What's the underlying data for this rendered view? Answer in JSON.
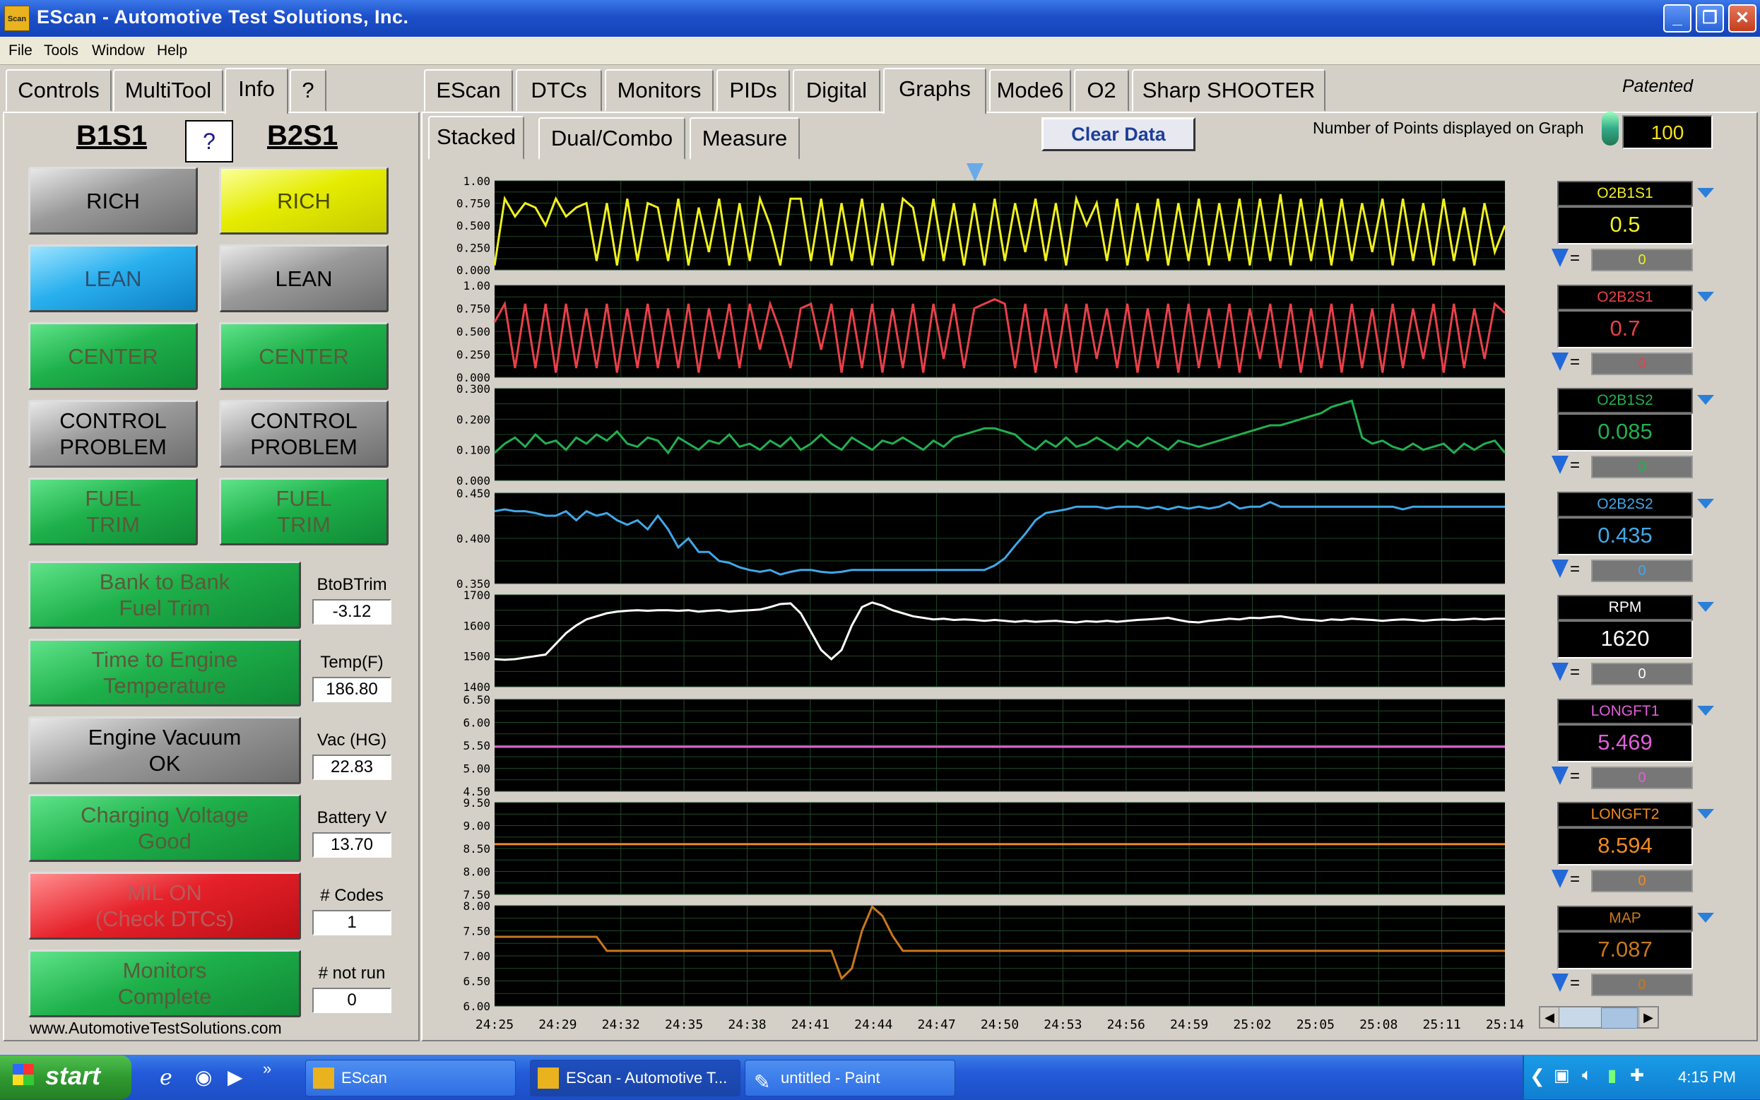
{
  "window": {
    "title": "EScan - Automotive Test Solutions, Inc.",
    "app_icon_text": "Scan"
  },
  "menu": [
    "File",
    "Tools",
    "Window",
    "Help"
  ],
  "left_tabs": [
    "Controls",
    "MultiTool",
    "Info",
    "?"
  ],
  "main_tabs": [
    "EScan",
    "DTCs",
    "Monitors",
    "PIDs",
    "Digital",
    "Graphs",
    "Mode6",
    "O2",
    "Sharp SHOOTER"
  ],
  "selected_main_tab": "Graphs",
  "patented": "Patented",
  "sub_tabs": [
    "Stacked",
    "Dual/Combo",
    "Measure"
  ],
  "clear_button": "Clear Data",
  "points_label": "Number of Points displayed on Graph",
  "points_value": "100",
  "banks": {
    "left": "B1S1",
    "help": "?",
    "right": "B2S1"
  },
  "b1s1": [
    {
      "text": "RICH",
      "color": "gray"
    },
    {
      "text": "LEAN",
      "color": "blue"
    },
    {
      "text": "CENTER",
      "color": "green"
    },
    {
      "text": "CONTROL\nPROBLEM",
      "color": "gray"
    },
    {
      "text": "FUEL\nTRIM",
      "color": "green"
    }
  ],
  "b2s1": [
    {
      "text": "RICH",
      "color": "yellow"
    },
    {
      "text": "LEAN",
      "color": "gray"
    },
    {
      "text": "CENTER",
      "color": "green"
    },
    {
      "text": "CONTROL\nPROBLEM",
      "color": "gray"
    },
    {
      "text": "FUEL\nTRIM",
      "color": "green"
    }
  ],
  "status_rows": [
    {
      "text": "Bank to Bank\nFuel Trim",
      "color": "green",
      "label": "BtoBTrim",
      "value": "-3.12"
    },
    {
      "text": "Time to Engine\nTemperature",
      "color": "green",
      "label": "Temp(F)",
      "value": "186.80"
    },
    {
      "text": "Engine Vacuum\nOK",
      "color": "gray",
      "label": "Vac (HG)",
      "value": "22.83"
    },
    {
      "text": "Charging Voltage\nGood",
      "color": "green",
      "label": "Battery V",
      "value": "13.70"
    },
    {
      "text": "MIL ON\n(Check DTCs)",
      "color": "red",
      "label": "# Codes",
      "value": "1"
    },
    {
      "text": "Monitors\nComplete",
      "color": "green",
      "label": "# not run",
      "value": "0"
    }
  ],
  "website": "www.AutomotiveTestSolutions.com",
  "x_ticks": [
    "24:25",
    "24:29",
    "24:32",
    "24:35",
    "24:38",
    "24:41",
    "24:44",
    "24:47",
    "24:50",
    "24:53",
    "24:56",
    "24:59",
    "25:02",
    "25:05",
    "25:08",
    "25:11",
    "25:14"
  ],
  "channels": [
    {
      "name": "O2B1S1",
      "value": "0.5",
      "cursor": "0",
      "color": "#f0f020",
      "ticks": [
        "1.00",
        "0.750",
        "0.500",
        "0.250",
        "0.000"
      ],
      "min": 0,
      "max": 1
    },
    {
      "name": "O2B2S1",
      "value": "0.7",
      "cursor": "0",
      "color": "#e8404a",
      "ticks": [
        "1.00",
        "0.750",
        "0.500",
        "0.250",
        "0.000"
      ],
      "min": 0,
      "max": 1
    },
    {
      "name": "O2B1S2",
      "value": "0.085",
      "cursor": "0",
      "color": "#22b050",
      "ticks": [
        "0.300",
        "0.200",
        "0.100",
        "0.000"
      ],
      "min": 0,
      "max": 0.3
    },
    {
      "name": "O2B2S2",
      "value": "0.435",
      "cursor": "0",
      "color": "#40a8e8",
      "ticks": [
        "0.450",
        "0.400",
        "0.350"
      ],
      "min": 0.35,
      "max": 0.45
    },
    {
      "name": "RPM",
      "value": "1620",
      "cursor": "0",
      "color": "#ffffff",
      "ticks": [
        "1700",
        "1600",
        "1500",
        "1400"
      ],
      "min": 1400,
      "max": 1700
    },
    {
      "name": "LONGFT1",
      "value": "5.469",
      "cursor": "0",
      "color": "#e060d8",
      "ticks": [
        "6.50",
        "6.00",
        "5.50",
        "5.00",
        "4.50"
      ],
      "min": 4.5,
      "max": 6.5
    },
    {
      "name": "LONGFT2",
      "value": "8.594",
      "cursor": "0",
      "color": "#f08a20",
      "ticks": [
        "9.50",
        "9.00",
        "8.50",
        "8.00",
        "7.50"
      ],
      "min": 7.5,
      "max": 9.5
    },
    {
      "name": "MAP",
      "value": "7.087",
      "cursor": "0",
      "color": "#c8781c",
      "ticks": [
        "8.00",
        "7.50",
        "7.00",
        "6.50",
        "6.00"
      ],
      "min": 6,
      "max": 8
    }
  ],
  "chart_data": {
    "type": "line",
    "title": "",
    "x": "time",
    "series": [
      {
        "name": "O2B1S1",
        "values": [
          0.05,
          0.8,
          0.6,
          0.75,
          0.7,
          0.5,
          0.8,
          0.6,
          0.7,
          0.75,
          0.1,
          0.75,
          0.05,
          0.8,
          0.1,
          0.75,
          0.7,
          0.1,
          0.8,
          0.05,
          0.7,
          0.2,
          0.8,
          0.05,
          0.75,
          0.1,
          0.8,
          0.5,
          0.05,
          0.8,
          0.8,
          0.1,
          0.8,
          0.05,
          0.75,
          0.1,
          0.8,
          0.05,
          0.75,
          0.05,
          0.8,
          0.7,
          0.1,
          0.8,
          0.1,
          0.75,
          0.05,
          0.75,
          0.05,
          0.8,
          0.1,
          0.75,
          0.2,
          0.8,
          0.1,
          0.75,
          0.05,
          0.8,
          0.5,
          0.75,
          0.1,
          0.8,
          0.05,
          0.75,
          0.1,
          0.8,
          0.05,
          0.75,
          0.1,
          0.8,
          0.05,
          0.75,
          0.1,
          0.8,
          0.05,
          0.8,
          0.1,
          0.85,
          0.05,
          0.8,
          0.1,
          0.8,
          0.05,
          0.8,
          0.1,
          0.75,
          0.2,
          0.8,
          0.05,
          0.8,
          0.1,
          0.75,
          0.05,
          0.8,
          0.1,
          0.7,
          0.05,
          0.75,
          0.2,
          0.5
        ]
      },
      {
        "name": "O2B2S1",
        "values": [
          0.6,
          0.8,
          0.1,
          0.8,
          0.1,
          0.8,
          0.05,
          0.8,
          0.1,
          0.75,
          0.1,
          0.8,
          0.05,
          0.75,
          0.1,
          0.8,
          0.1,
          0.75,
          0.1,
          0.8,
          0.05,
          0.75,
          0.2,
          0.8,
          0.1,
          0.8,
          0.3,
          0.8,
          0.5,
          0.1,
          0.75,
          0.8,
          0.3,
          0.8,
          0.05,
          0.75,
          0.1,
          0.8,
          0.05,
          0.75,
          0.1,
          0.8,
          0.05,
          0.8,
          0.2,
          0.8,
          0.1,
          0.75,
          0.8,
          0.85,
          0.8,
          0.1,
          0.8,
          0.05,
          0.75,
          0.1,
          0.8,
          0.05,
          0.8,
          0.2,
          0.75,
          0.1,
          0.8,
          0.05,
          0.75,
          0.1,
          0.8,
          0.05,
          0.8,
          0.1,
          0.75,
          0.1,
          0.8,
          0.05,
          0.75,
          0.2,
          0.8,
          0.1,
          0.8,
          0.05,
          0.75,
          0.1,
          0.8,
          0.05,
          0.8,
          0.1,
          0.75,
          0.05,
          0.8,
          0.1,
          0.75,
          0.2,
          0.8,
          0.05,
          0.8,
          0.1,
          0.75,
          0.2,
          0.8,
          0.7
        ]
      },
      {
        "name": "O2B1S2",
        "values": [
          0.09,
          0.12,
          0.14,
          0.11,
          0.15,
          0.12,
          0.13,
          0.1,
          0.14,
          0.12,
          0.15,
          0.13,
          0.16,
          0.12,
          0.11,
          0.14,
          0.13,
          0.09,
          0.14,
          0.12,
          0.1,
          0.13,
          0.12,
          0.15,
          0.11,
          0.12,
          0.1,
          0.13,
          0.11,
          0.14,
          0.1,
          0.12,
          0.15,
          0.12,
          0.1,
          0.14,
          0.12,
          0.1,
          0.13,
          0.12,
          0.14,
          0.12,
          0.1,
          0.13,
          0.11,
          0.14,
          0.15,
          0.16,
          0.17,
          0.17,
          0.16,
          0.15,
          0.12,
          0.1,
          0.13,
          0.11,
          0.14,
          0.11,
          0.12,
          0.14,
          0.12,
          0.1,
          0.13,
          0.11,
          0.14,
          0.12,
          0.1,
          0.13,
          0.12,
          0.11,
          0.12,
          0.13,
          0.14,
          0.15,
          0.16,
          0.17,
          0.18,
          0.18,
          0.19,
          0.2,
          0.21,
          0.22,
          0.24,
          0.25,
          0.26,
          0.14,
          0.12,
          0.13,
          0.11,
          0.1,
          0.12,
          0.1,
          0.11,
          0.12,
          0.09,
          0.12,
          0.1,
          0.12,
          0.13,
          0.09
        ]
      },
      {
        "name": "O2B2S2",
        "values": [
          0.43,
          0.432,
          0.43,
          0.43,
          0.428,
          0.425,
          0.425,
          0.43,
          0.42,
          0.43,
          0.425,
          0.428,
          0.42,
          0.415,
          0.42,
          0.41,
          0.425,
          0.41,
          0.39,
          0.4,
          0.385,
          0.385,
          0.375,
          0.373,
          0.368,
          0.365,
          0.363,
          0.365,
          0.36,
          0.363,
          0.365,
          0.365,
          0.363,
          0.362,
          0.363,
          0.365,
          0.365,
          0.365,
          0.365,
          0.365,
          0.365,
          0.365,
          0.365,
          0.365,
          0.365,
          0.365,
          0.365,
          0.365,
          0.365,
          0.37,
          0.378,
          0.392,
          0.405,
          0.42,
          0.428,
          0.43,
          0.432,
          0.435,
          0.435,
          0.435,
          0.433,
          0.435,
          0.435,
          0.435,
          0.433,
          0.435,
          0.432,
          0.435,
          0.433,
          0.435,
          0.433,
          0.435,
          0.44,
          0.433,
          0.435,
          0.435,
          0.44,
          0.435,
          0.435,
          0.435,
          0.435,
          0.435,
          0.435,
          0.435,
          0.435,
          0.435,
          0.435,
          0.435,
          0.435,
          0.432,
          0.435,
          0.435,
          0.435,
          0.435,
          0.435,
          0.435,
          0.435,
          0.435,
          0.435,
          0.435
        ]
      },
      {
        "name": "RPM",
        "values": [
          1490,
          1488,
          1490,
          1495,
          1500,
          1505,
          1540,
          1575,
          1600,
          1620,
          1630,
          1640,
          1645,
          1648,
          1650,
          1648,
          1650,
          1650,
          1648,
          1650,
          1645,
          1648,
          1650,
          1645,
          1648,
          1650,
          1652,
          1660,
          1670,
          1672,
          1640,
          1580,
          1520,
          1490,
          1520,
          1600,
          1660,
          1675,
          1665,
          1650,
          1640,
          1630,
          1625,
          1620,
          1622,
          1618,
          1620,
          1618,
          1615,
          1618,
          1615,
          1612,
          1615,
          1612,
          1614,
          1615,
          1612,
          1610,
          1614,
          1612,
          1615,
          1612,
          1615,
          1618,
          1620,
          1622,
          1625,
          1618,
          1612,
          1610,
          1615,
          1618,
          1622,
          1620,
          1625,
          1624,
          1628,
          1630,
          1625,
          1620,
          1618,
          1615,
          1620,
          1618,
          1622,
          1620,
          1618,
          1615,
          1618,
          1620,
          1618,
          1615,
          1618,
          1620,
          1618,
          1620,
          1622,
          1620,
          1622,
          1622
        ]
      },
      {
        "name": "LONGFT1",
        "values": [
          5.469,
          5.469
        ]
      },
      {
        "name": "LONGFT2",
        "values": [
          8.594,
          8.594
        ]
      },
      {
        "name": "MAP",
        "values": [
          7.38,
          7.38,
          7.38,
          7.38,
          7.38,
          7.38,
          7.38,
          7.38,
          7.38,
          7.38,
          7.38,
          7.1,
          7.1,
          7.1,
          7.1,
          7.1,
          7.1,
          7.1,
          7.1,
          7.1,
          7.1,
          7.1,
          7.1,
          7.1,
          7.1,
          7.1,
          7.1,
          7.1,
          7.1,
          7.1,
          7.1,
          7.1,
          7.1,
          7.1,
          6.55,
          6.75,
          7.5,
          7.98,
          7.8,
          7.4,
          7.1,
          7.1,
          7.1,
          7.1,
          7.1,
          7.1,
          7.1,
          7.1,
          7.1,
          7.1,
          7.1,
          7.1,
          7.1,
          7.1,
          7.1,
          7.1,
          7.1,
          7.1,
          7.1,
          7.1,
          7.1,
          7.1,
          7.1,
          7.1,
          7.1,
          7.1,
          7.1,
          7.1,
          7.1,
          7.1,
          7.1,
          7.1,
          7.1,
          7.1,
          7.1,
          7.1,
          7.1,
          7.1,
          7.1,
          7.1,
          7.1,
          7.1,
          7.1,
          7.1,
          7.1,
          7.1,
          7.1,
          7.1,
          7.1,
          7.1,
          7.1,
          7.1,
          7.1,
          7.1,
          7.1,
          7.1,
          7.1,
          7.1,
          7.1,
          7.1
        ]
      }
    ]
  },
  "taskbar": {
    "start": "start",
    "tasks": [
      "EScan",
      "EScan - Automotive T...",
      "untitled - Paint"
    ],
    "clock": "4:15 PM"
  }
}
